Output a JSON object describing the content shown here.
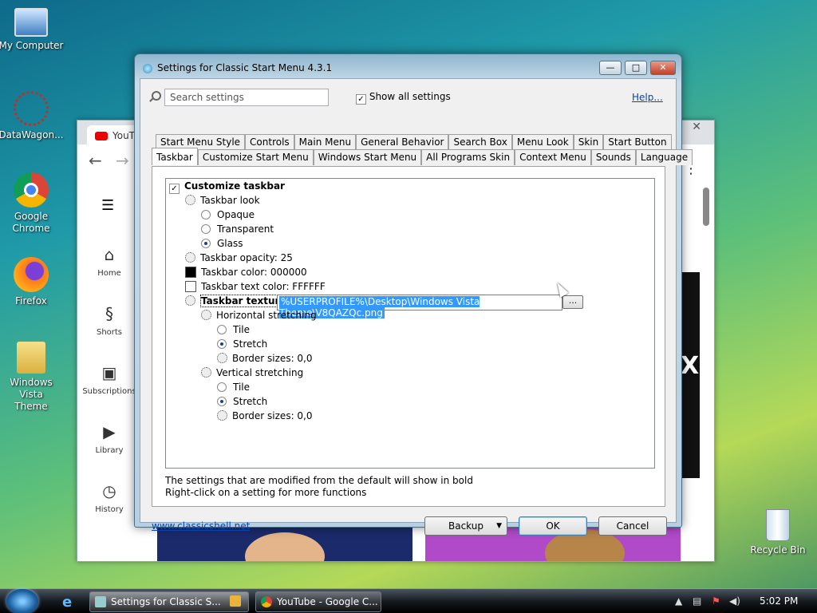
{
  "desktop": {
    "icons": [
      {
        "label": "My Computer"
      },
      {
        "label": "DataWagon..."
      },
      {
        "label": "Google Chrome"
      },
      {
        "label": "Firefox"
      },
      {
        "label": "Windows Vista Theme"
      },
      {
        "label": "Recycle Bin"
      }
    ]
  },
  "browser": {
    "tab_label": "YouT",
    "side": [
      {
        "label": "Home"
      },
      {
        "label": "Shorts"
      },
      {
        "label": "Subscriptions"
      },
      {
        "label": "Library"
      },
      {
        "label": "History"
      }
    ]
  },
  "dialog": {
    "title": "Settings for Classic Start Menu 4.3.1",
    "search_placeholder": "Search settings",
    "show_all_label": "Show all settings",
    "help_label": "Help...",
    "tabs_row1": [
      "Start Menu Style",
      "Controls",
      "Main Menu",
      "General Behavior",
      "Search Box",
      "Menu Look",
      "Skin",
      "Start Button"
    ],
    "tabs_row2": [
      "Taskbar",
      "Customize Start Menu",
      "Windows Start Menu",
      "All Programs Skin",
      "Context Menu",
      "Sounds",
      "Language"
    ],
    "active_tab": "Taskbar",
    "tree": {
      "customize_taskbar": "Customize taskbar",
      "taskbar_look": "Taskbar look",
      "opaque": "Opaque",
      "transparent": "Transparent",
      "glass": "Glass",
      "taskbar_opacity": "Taskbar opacity: 25",
      "taskbar_color": "Taskbar color: 000000",
      "taskbar_text_color": "Taskbar text color: FFFFFF",
      "taskbar_texture": "Taskbar texture",
      "texture_value": "%USERPROFILE%\\Desktop\\Windows Vista Theme\\V8QAZQc.png",
      "browse_label": "...",
      "horizontal_stretching": "Horizontal stretching",
      "h_tile": "Tile",
      "h_stretch": "Stretch",
      "h_border": "Border sizes: 0,0",
      "vertical_stretching": "Vertical stretching",
      "v_tile": "Tile",
      "v_stretch": "Stretch",
      "v_border": "Border sizes: 0,0"
    },
    "hint1": "The settings that are modified from the default will show in bold",
    "hint2": "Right-click on a setting for more functions",
    "website": "www.classicshell.net",
    "backup_label": "Backup",
    "ok_label": "OK",
    "cancel_label": "Cancel",
    "minimize": "—",
    "maximize": "□",
    "close": "✕"
  },
  "taskbar": {
    "tasks": [
      {
        "label": "Settings for Classic S..."
      },
      {
        "label": ""
      },
      {
        "label": "YouTube - Google C..."
      }
    ],
    "clock": "5:02 PM"
  },
  "colors": {
    "taskbar_color": "#000000",
    "taskbar_text_color": "#FFFFFF",
    "selection": "#3399ff"
  }
}
